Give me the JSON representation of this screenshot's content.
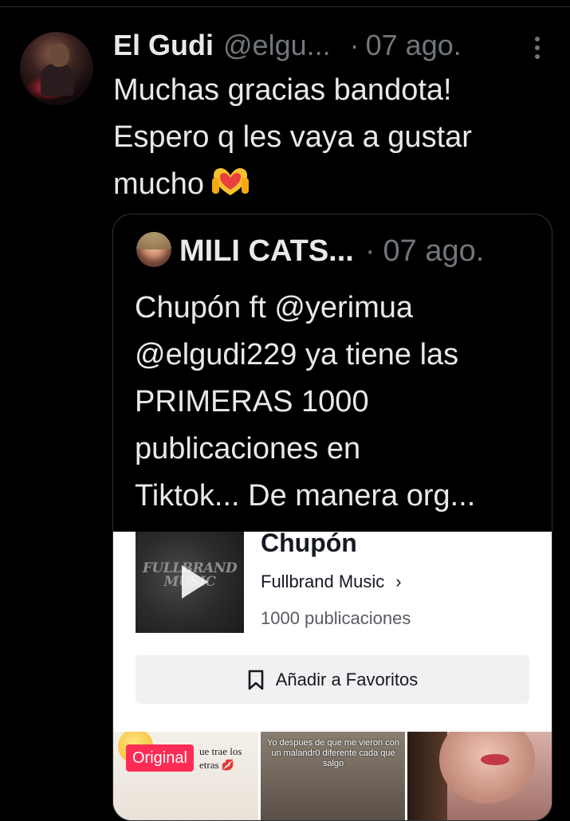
{
  "tweet": {
    "author_name": "El Gudi",
    "author_handle": "@elgu...",
    "separator": "·",
    "date": "07 ago.",
    "text_lines": [
      "Muchas gracias bandota!",
      "Espero q les vaya a gustar",
      "mucho"
    ],
    "emoji_icon": "heart-hands-icon"
  },
  "quote": {
    "author_name": "MILI CATS...",
    "separator": "·",
    "date": "07 ago.",
    "text_lines": [
      "Chupón ft @yerimua",
      "@elgudi229 ya tiene las",
      "PRIMERAS 1000",
      "publicaciones en",
      "Tiktok... De manera org..."
    ]
  },
  "media": {
    "thumb_logo_line1": "FULLBRAND",
    "thumb_logo_line2": "MUSIC",
    "song_title": "Chupón",
    "artist": "Fullbrand Music",
    "artist_chevron": "›",
    "publications": "1000 publicaciones",
    "favorite_label": "Añadir a Favoritos",
    "videos": [
      {
        "badge": "Original",
        "caption": "ue trae los etras 💋"
      },
      {
        "caption": "Yo despues de que me vieron con un malandr0 diferente cada que salgo"
      },
      {
        "caption": ""
      }
    ]
  },
  "colors": {
    "background": "#000000",
    "text_primary": "#e7e9ea",
    "text_secondary": "#71767b",
    "border": "#2f3336",
    "tiktok_red": "#fe2c55"
  }
}
